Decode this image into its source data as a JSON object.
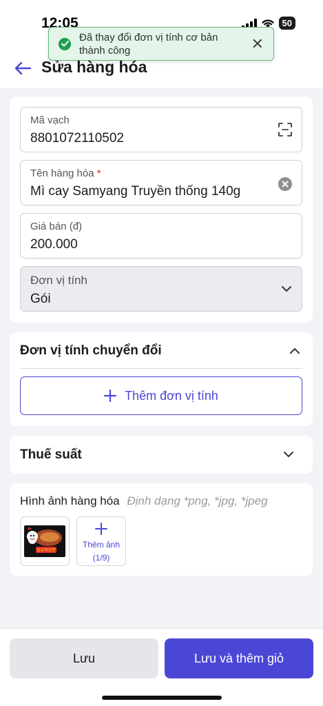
{
  "status_bar": {
    "time": "12:05",
    "battery": "50"
  },
  "toast": {
    "message": "Đã thay đổi đơn vị tính cơ bản thành công",
    "close": "✕"
  },
  "header": {
    "title": "Sửa hàng hóa"
  },
  "form": {
    "barcode": {
      "label": "Mã vạch",
      "value": "8801072110502"
    },
    "name": {
      "label": "Tên hàng hóa",
      "required_mark": "*",
      "value": "Mì cay Samyang Truyền thống 140g"
    },
    "price": {
      "label": "Giá bán (đ)",
      "value": "200.000"
    },
    "unit": {
      "label": "Đơn vị tính",
      "value": "Gói"
    }
  },
  "conversion_units": {
    "title": "Đơn vị tính chuyển đổi",
    "add_button": "Thêm đơn vị tính"
  },
  "tax": {
    "title": "Thuế suất"
  },
  "images": {
    "title": "Hình ảnh hàng hóa",
    "hint": "Định dạng *png, *jpg, *jpeg",
    "add_label": "Thêm ảnh",
    "count": "(1/9)",
    "product_text": "불닭볶음면"
  },
  "footer": {
    "save": "Lưu",
    "save_and_add": "Lưu và thêm giỏ"
  },
  "colors": {
    "accent": "#4b47d6",
    "success": "#1f9d4f",
    "required": "#e0262d"
  }
}
